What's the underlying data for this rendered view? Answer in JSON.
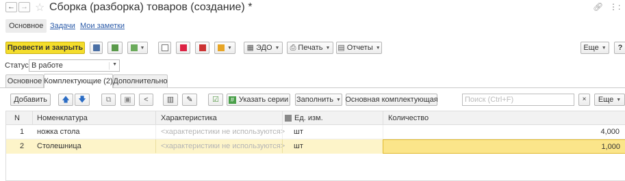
{
  "window": {
    "back": "←",
    "forward": "→",
    "title": "Сборка (разборка) товаров (создание) *",
    "link_icon": "link-icon",
    "more_icon": "vertical-dots-icon"
  },
  "top_tabs": [
    {
      "label": "Основное"
    },
    {
      "label": "Задачи"
    },
    {
      "label": "Мои заметки"
    }
  ],
  "toolbar": {
    "post_close": "Провести и закрыть",
    "edo": "ЭДО",
    "print": "Печать",
    "reports": "Отчеты",
    "more": "Еще",
    "help": "?"
  },
  "status": {
    "label": "Статус:",
    "value": "В работе"
  },
  "form_tabs": [
    {
      "label": "Основное"
    },
    {
      "label": "Комплектующие (2)"
    },
    {
      "label": "Дополнительно"
    }
  ],
  "table_toolbar": {
    "add": "Добавить",
    "series": "Указать серии",
    "fill": "Заполнить",
    "main_component": "Основная комплектующая",
    "search_placeholder": "Поиск (Ctrl+F)",
    "clear": "×",
    "more": "Еще"
  },
  "table": {
    "columns": [
      "N",
      "Номенклатура",
      "Характеристика",
      "Ед. изм.",
      "Количество"
    ],
    "rows": [
      {
        "n": "1",
        "item": "ножка стола",
        "characteristic": "<характеристики не используются>",
        "unit": "шт",
        "qty": "4,000"
      },
      {
        "n": "2",
        "item": "Столешница",
        "characteristic": "<характеристики не используются>",
        "unit": "шт",
        "qty": "1,000"
      }
    ]
  },
  "colors": {
    "accent_yellow": "#f4dd2b",
    "selected_row": "#fdf4c9",
    "active_cell": "#fbe58a",
    "link": "#2a5aa8"
  }
}
